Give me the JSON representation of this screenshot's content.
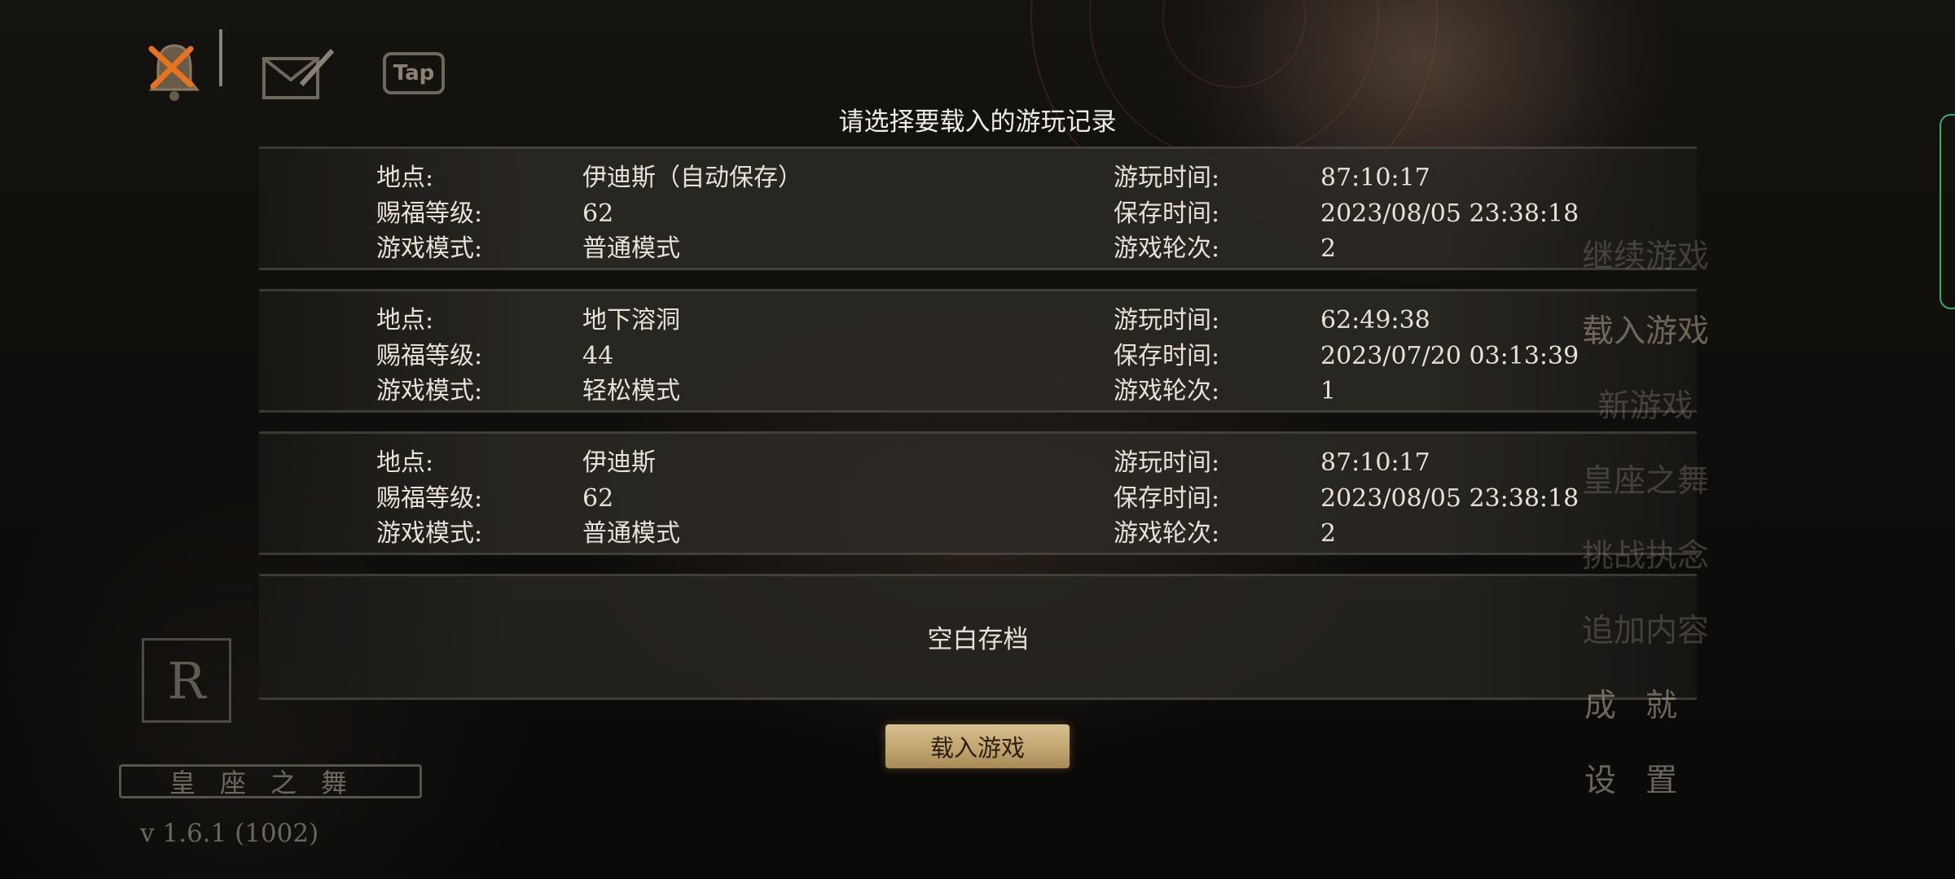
{
  "header": {
    "title": "请选择要载入的游玩记录",
    "icons": [
      "bell-icon",
      "mail-icon",
      "tap-icon"
    ],
    "tap_label": "Tap"
  },
  "slots": [
    {
      "location_label": "地点:",
      "location": "伊迪斯（自动保存）",
      "level_label": "赐福等级:",
      "level": "62",
      "mode_label": "游戏模式:",
      "mode": "普通模式",
      "playtime_label": "游玩时间:",
      "playtime": "87:10:17",
      "savetime_label": "保存时间:",
      "savetime": "2023/08/05 23:38:18",
      "cycle_label": "游戏轮次:",
      "cycle": "2"
    },
    {
      "location_label": "地点:",
      "location": "地下溶洞",
      "level_label": "赐福等级:",
      "level": "44",
      "mode_label": "游戏模式:",
      "mode": "轻松模式",
      "playtime_label": "游玩时间:",
      "playtime": "62:49:38",
      "savetime_label": "保存时间:",
      "savetime": "2023/07/20 03:13:39",
      "cycle_label": "游戏轮次:",
      "cycle": "1"
    },
    {
      "location_label": "地点:",
      "location": "伊迪斯",
      "level_label": "赐福等级:",
      "level": "62",
      "mode_label": "游戏模式:",
      "mode": "普通模式",
      "playtime_label": "游玩时间:",
      "playtime": "87:10:17",
      "savetime_label": "保存时间:",
      "savetime": "2023/08/05 23:38:18",
      "cycle_label": "游戏轮次:",
      "cycle": "2"
    }
  ],
  "empty_slot": "空白存档",
  "load_button": "载入游戏",
  "menu": {
    "items": [
      "继续游戏",
      "载入游戏",
      "新游戏",
      "皇座之舞",
      "挑战执念",
      "追加内容",
      "成就",
      "设置"
    ]
  },
  "bottom_left": {
    "logo_letter": "R",
    "banner": "皇座之舞",
    "version": "v 1.6.1 (1002)"
  },
  "colors": {
    "accent_gold": "#c7ab74",
    "text": "#e8e2d6",
    "edge_green": "#2fb36a"
  }
}
